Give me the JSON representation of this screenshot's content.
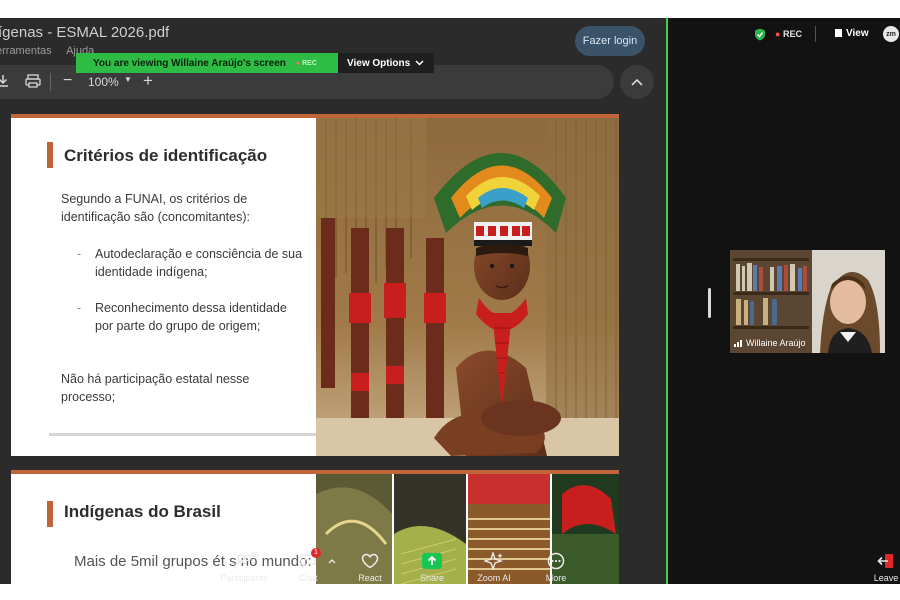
{
  "pdf": {
    "title": "ígenas - ESMAL 2026.pdf",
    "menu": [
      "erramentas",
      "Ajuda"
    ],
    "zoom": "100%",
    "login_button": "Fazer login"
  },
  "share_banner": {
    "text": "You are viewing  Willaine Araújo's screen",
    "rec": "REC",
    "view_options": "View Options"
  },
  "slide1": {
    "title": "Critérios de identificação",
    "intro": "Segundo a FUNAI, os critérios de identificação são (concomitantes):",
    "bullets": [
      "Autodeclaração e consciência de sua identidade indígena;",
      "Reconhecimento dessa identidade por parte do grupo de origem;"
    ],
    "note": "Não há participação estatal nesse processo;"
  },
  "slide2": {
    "title": "Indígenas do Brasil",
    "bullet": "Mais de 5mil grupos ét   s no   mundo:"
  },
  "meeting": {
    "rec": "REC",
    "view": "View",
    "logo": "zm",
    "participant_name": "Willaine Araújo"
  },
  "controls": {
    "participants": "Participants",
    "participants_count": "69",
    "chat": "Chat",
    "chat_badge": "1",
    "react": "React",
    "share": "Share",
    "zoom_ai": "Zoom AI",
    "more": "More",
    "leave": "Leave"
  },
  "colors": {
    "accent_slide": "#c0643a",
    "share_banner": "#2fbc44",
    "share_button": "#17c653"
  }
}
